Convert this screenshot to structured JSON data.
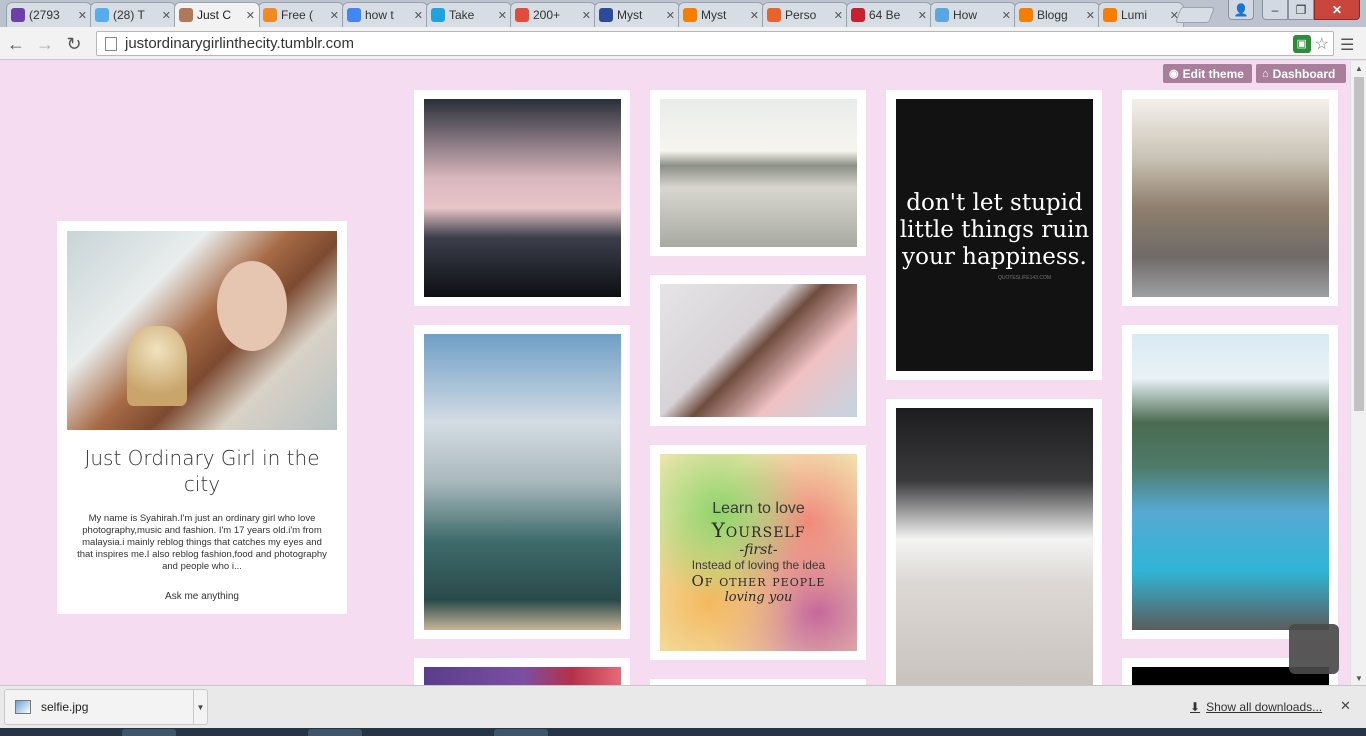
{
  "browser": {
    "tabs": [
      {
        "title": "(2793",
        "icon": "mail-icon",
        "color": "#6d3fa8",
        "active": false
      },
      {
        "title": "(28) T",
        "icon": "twitter-icon",
        "color": "#55acee",
        "active": false
      },
      {
        "title": "Just C",
        "icon": "profile-photo-icon",
        "color": "#b07a5a",
        "active": true
      },
      {
        "title": "Free (",
        "icon": "heart-icon",
        "color": "#f08a24",
        "active": false
      },
      {
        "title": "how t",
        "icon": "google-icon",
        "color": "#4285f4",
        "active": false
      },
      {
        "title": "Take",
        "icon": "windows-icon",
        "color": "#1fa3e0",
        "active": false
      },
      {
        "title": "200+",
        "icon": "c-icon",
        "color": "#e24c3b",
        "active": false
      },
      {
        "title": "Myst",
        "icon": "b-icon",
        "color": "#2d4a9a",
        "active": false
      },
      {
        "title": "Myst",
        "icon": "blogger-icon",
        "color": "#f57d00",
        "active": false
      },
      {
        "title": "Perso",
        "icon": "et-icon",
        "color": "#e8632b",
        "active": false
      },
      {
        "title": "64 Be",
        "icon": "wave-icon",
        "color": "#c8202f",
        "active": false
      },
      {
        "title": "How",
        "icon": "cube-icon",
        "color": "#5aa6e0",
        "active": false
      },
      {
        "title": "Blogg",
        "icon": "blogger-icon",
        "color": "#f57d00",
        "active": false
      },
      {
        "title": "Lumi",
        "icon": "blogger-icon",
        "color": "#f57d00",
        "active": false
      }
    ],
    "url": "justordinarygirlinthecity.tumblr.com"
  },
  "theme_bar": {
    "edit_label": "Edit theme",
    "dashboard_label": "Dashboard",
    "accent": "#a87e9b"
  },
  "profile": {
    "name": "Just Ordinary Girl in the city",
    "bio": "My name is Syahirah.I'm just an ordinary girl who love photography,music and fashion. I'm 17 years old.i'm from malaysia.i mainly reblog things that catches my eyes and that inspires me.I also reblog fashion,food and photography and people who i...",
    "ask_link": "Ask me anything"
  },
  "posts": {
    "quote_text": "don't let stupid little things ruin your happiness.",
    "quote_source": "QUOTESLIFE143.COM",
    "love_lines": [
      "Learn to love",
      "Yourself",
      "-first-",
      "Instead of loving the idea",
      "Of other people",
      "loving you"
    ]
  },
  "downloads": {
    "file_name": "selfie.jpg",
    "show_all_label": "Show all downloads..."
  },
  "colors": {
    "page_background": "#f6dcf1",
    "card_background": "#ffffff"
  }
}
